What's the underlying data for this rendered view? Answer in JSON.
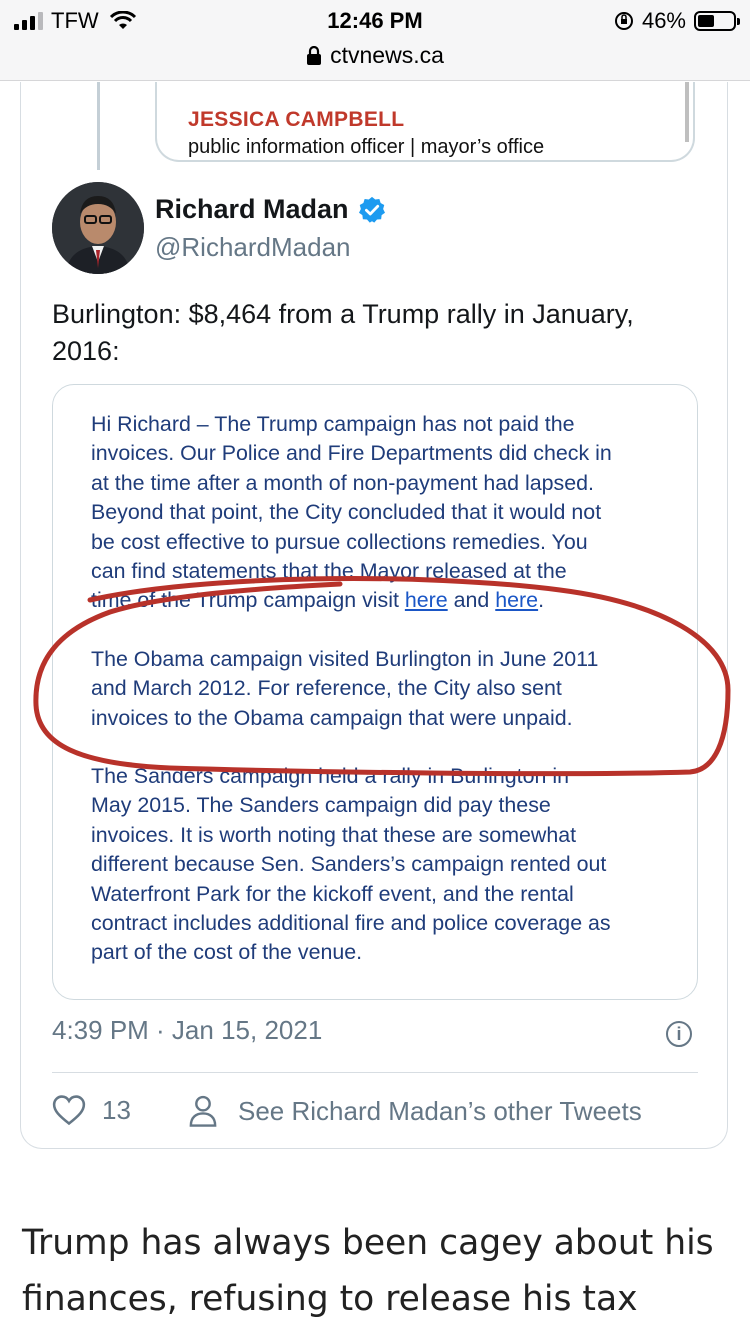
{
  "status_bar": {
    "carrier": "TFW",
    "time": "12:46 PM",
    "battery_percent": "46%",
    "battery_level": 0.46,
    "url": "ctvnews.ca"
  },
  "quoted_letter_header": {
    "name": "JESSICA CAMPBELL",
    "title": "public information officer | mayor’s office"
  },
  "tweet": {
    "author_name": "Richard Madan",
    "author_handle": "@RichardMadan",
    "verified": true,
    "text": "Burlington: $8,464 from a Trump rally in January, 2016:",
    "timestamp": "4:39 PM · Jan 15, 2021",
    "like_count": "13",
    "other_tweets_label": "See Richard Madan’s other Tweets"
  },
  "letter_image": {
    "para1_lines": [
      "Hi Richard – The Trump campaign has not paid the",
      "invoices. Our Police and Fire Departments did check in",
      "at the time after a month of non-payment had lapsed.",
      "Beyond that point, the City concluded that it would not",
      "be cost effective to pursue collections remedies. You",
      "can find statements that the Mayor released at the"
    ],
    "para1_last_prefix": "time of the Trump campaign visit ",
    "link1": "here",
    "link_joiner": " and ",
    "link2": "here",
    "para1_end": ".",
    "para2_lines": [
      "The Obama campaign visited Burlington in June 2011",
      "and March 2012. For reference, the City also sent",
      "invoices to the Obama campaign that were unpaid."
    ],
    "para3_lines": [
      "The Sanders campaign held a rally in Burlington in",
      "May 2015. The Sanders campaign did pay these",
      "invoices. It is worth noting that these are somewhat",
      "different because Sen. Sanders’s campaign rented out",
      "Waterfront Park for the kickoff event, and the rental",
      "contract includes additional fire and police coverage as",
      "part of the cost of the venue."
    ],
    "annotation_color": "#b8322a"
  },
  "article": {
    "text_line1": "Trump has always been cagey about his",
    "text_line2": "finances, refusing to release his tax"
  },
  "colors": {
    "twitter_blue": "#1d9bf0",
    "muted_text": "#657786",
    "letter_text": "#1f3c7a"
  }
}
